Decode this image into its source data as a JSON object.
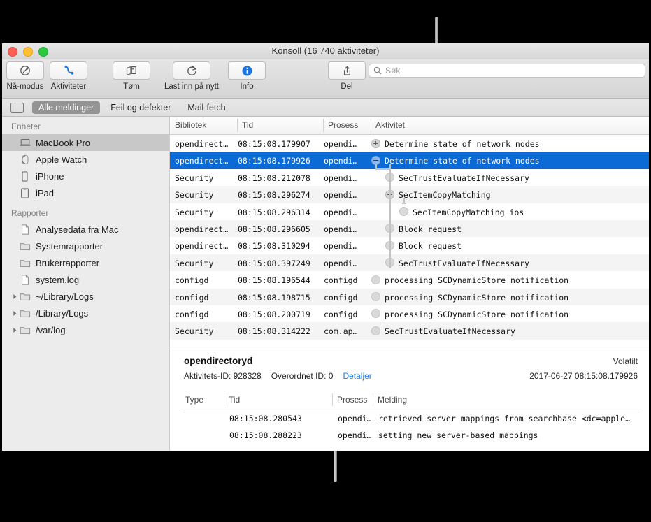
{
  "window": {
    "title": "Konsoll (16 740 aktiviteter)",
    "traffic_lights": [
      "close-button",
      "minimize-button",
      "zoom-button"
    ]
  },
  "toolbar": {
    "items": [
      {
        "label": "Nå-modus",
        "icon": "now-mode-icon"
      },
      {
        "label": "Aktiviteter",
        "icon": "activities-icon"
      },
      {
        "label": "Tøm",
        "icon": "clear-icon"
      },
      {
        "label": "Last inn på nytt",
        "icon": "reload-icon"
      },
      {
        "label": "Info",
        "icon": "info-icon"
      },
      {
        "label": "Del",
        "icon": "share-icon"
      }
    ],
    "search": {
      "placeholder": "Søk",
      "value": ""
    }
  },
  "filterbar": {
    "sidebar_toggle": "sidebar-toggle-icon",
    "tabs": [
      {
        "label": "Alle meldinger",
        "active": true
      },
      {
        "label": "Feil og defekter",
        "active": false
      },
      {
        "label": "Mail-fetch",
        "active": false
      }
    ]
  },
  "sidebar": {
    "groups": [
      {
        "header": "Enheter",
        "items": [
          {
            "label": "MacBook Pro",
            "icon": "laptop-icon",
            "selected": true,
            "disclosure": false
          },
          {
            "label": "Apple Watch",
            "icon": "watch-icon",
            "selected": false,
            "disclosure": false
          },
          {
            "label": "iPhone",
            "icon": "iphone-icon",
            "selected": false,
            "disclosure": false
          },
          {
            "label": "iPad",
            "icon": "ipad-icon",
            "selected": false,
            "disclosure": false
          }
        ]
      },
      {
        "header": "Rapporter",
        "items": [
          {
            "label": "Analysedata fra Mac",
            "icon": "document-icon",
            "selected": false,
            "disclosure": false
          },
          {
            "label": "Systemrapporter",
            "icon": "folder-icon",
            "selected": false,
            "disclosure": false
          },
          {
            "label": "Brukerrapporter",
            "icon": "folder-icon",
            "selected": false,
            "disclosure": false
          },
          {
            "label": "system.log",
            "icon": "document-icon",
            "selected": false,
            "disclosure": false
          },
          {
            "label": "~/Library/Logs",
            "icon": "folder-icon",
            "selected": false,
            "disclosure": true
          },
          {
            "label": "/Library/Logs",
            "icon": "folder-icon",
            "selected": false,
            "disclosure": true
          },
          {
            "label": "/var/log",
            "icon": "folder-icon",
            "selected": false,
            "disclosure": true
          }
        ]
      }
    ]
  },
  "log_table": {
    "columns": [
      "Bibliotek",
      "Tid",
      "Prosess",
      "Aktivitet"
    ],
    "rows": [
      {
        "library": "opendirect…",
        "time": "08:15:08.179907",
        "process": "opendi…",
        "activity": "Determine state of network nodes",
        "indent": 0,
        "disclosure": "plus",
        "selected": false
      },
      {
        "library": "opendirect…",
        "time": "08:15:08.179926",
        "process": "opendi…",
        "activity": "Determine state of network nodes",
        "indent": 0,
        "disclosure": "minus",
        "selected": true
      },
      {
        "library": "Security",
        "time": "08:15:08.212078",
        "process": "opendi…",
        "activity": "SecTrustEvaluateIfNecessary",
        "indent": 1,
        "disclosure": "leaf",
        "selected": false
      },
      {
        "library": "Security",
        "time": "08:15:08.296274",
        "process": "opendi…",
        "activity": "SecItemCopyMatching",
        "indent": 1,
        "disclosure": "minus",
        "selected": false
      },
      {
        "library": "Security",
        "time": "08:15:08.296314",
        "process": "opendi…",
        "activity": "SecItemCopyMatching_ios",
        "indent": 2,
        "disclosure": "leaf",
        "selected": false
      },
      {
        "library": "opendirect…",
        "time": "08:15:08.296605",
        "process": "opendi…",
        "activity": "Block request",
        "indent": 1,
        "disclosure": "leaf",
        "selected": false
      },
      {
        "library": "opendirect…",
        "time": "08:15:08.310294",
        "process": "opendi…",
        "activity": "Block request",
        "indent": 1,
        "disclosure": "leaf",
        "selected": false
      },
      {
        "library": "Security",
        "time": "08:15:08.397249",
        "process": "opendi…",
        "activity": "SecTrustEvaluateIfNecessary",
        "indent": 1,
        "disclosure": "leaf",
        "selected": false
      },
      {
        "library": "configd",
        "time": "08:15:08.196544",
        "process": "configd",
        "activity": "processing SCDynamicStore notification",
        "indent": 0,
        "disclosure": "leaf",
        "selected": false
      },
      {
        "library": "configd",
        "time": "08:15:08.198715",
        "process": "configd",
        "activity": "processing SCDynamicStore notification",
        "indent": 0,
        "disclosure": "leaf",
        "selected": false
      },
      {
        "library": "configd",
        "time": "08:15:08.200719",
        "process": "configd",
        "activity": "processing SCDynamicStore notification",
        "indent": 0,
        "disclosure": "leaf",
        "selected": false
      },
      {
        "library": "Security",
        "time": "08:15:08.314222",
        "process": "com.ap…",
        "activity": "SecTrustEvaluateIfNecessary",
        "indent": 0,
        "disclosure": "leaf",
        "selected": false
      }
    ]
  },
  "detail": {
    "title": "opendirectoryd",
    "volatile": "Volatilt",
    "activity_id_label": "Aktivitets-ID: 928328",
    "parent_id_label": "Overordnet ID: 0",
    "details_link": "Detaljer",
    "timestamp": "2017-06-27 08:15:08.179926",
    "columns": [
      "Type",
      "Tid",
      "Prosess",
      "Melding"
    ],
    "rows": [
      {
        "type": "",
        "time": "08:15:08.280543",
        "process": "opendi…",
        "message": "retrieved server mappings from searchbase <dc=apple…"
      },
      {
        "type": "",
        "time": "08:15:08.288223",
        "process": "opendi…",
        "message": "setting new server-based mappings"
      }
    ]
  },
  "colors": {
    "selection_blue": "#0b6ad6",
    "link_blue": "#1b7fe0",
    "accent_icon_blue": "#1673e6",
    "callout_gray": "#a8a8a8"
  }
}
